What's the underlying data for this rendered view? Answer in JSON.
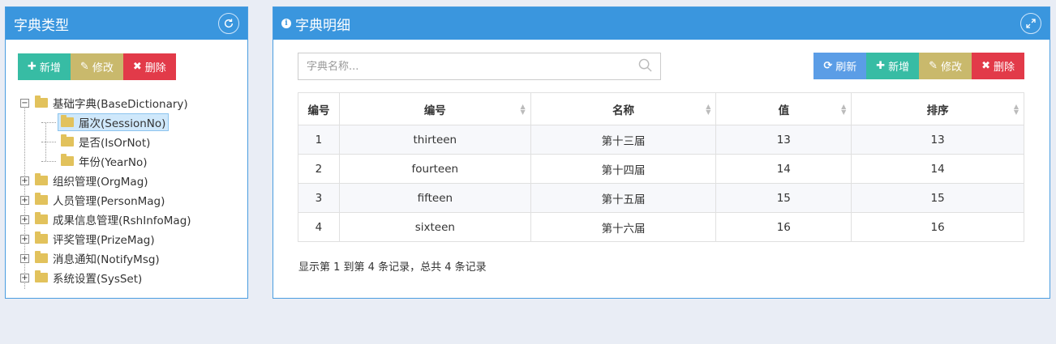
{
  "left_panel": {
    "title": "字典类型",
    "buttons": {
      "add": "新增",
      "edit": "修改",
      "delete": "删除"
    },
    "tree": {
      "root": {
        "label": "基础字典(BaseDictionary)",
        "expanded": true,
        "children": [
          "届次(SessionNo)",
          "是否(IsOrNot)",
          "年份(YearNo)"
        ]
      },
      "nodes": [
        "组织管理(OrgMag)",
        "人员管理(PersonMag)",
        "成果信息管理(RshInfoMag)",
        "评奖管理(PrizeMag)",
        "消息通知(NotifyMsg)",
        "系统设置(SysSet)"
      ],
      "selected": "届次(SessionNo)"
    }
  },
  "right_panel": {
    "title": "字典明细",
    "search": {
      "placeholder": "字典名称..."
    },
    "buttons": {
      "refresh": "刷新",
      "add": "新增",
      "edit": "修改",
      "delete": "删除"
    },
    "table": {
      "headers": [
        "编号",
        "编号",
        "名称",
        "值",
        "排序"
      ],
      "rows": [
        [
          "1",
          "thirteen",
          "第十三届",
          "13",
          "13"
        ],
        [
          "2",
          "fourteen",
          "第十四届",
          "14",
          "14"
        ],
        [
          "3",
          "fifteen",
          "第十五届",
          "15",
          "15"
        ],
        [
          "4",
          "sixteen",
          "第十六届",
          "16",
          "16"
        ]
      ]
    },
    "footer": "显示第 1 到第 4 条记录，总共 4 条记录"
  },
  "colors": {
    "header": "#3a96de",
    "teal": "#37bca4",
    "olive": "#c9b96c",
    "red": "#e23a49",
    "blue": "#5b9de6"
  }
}
